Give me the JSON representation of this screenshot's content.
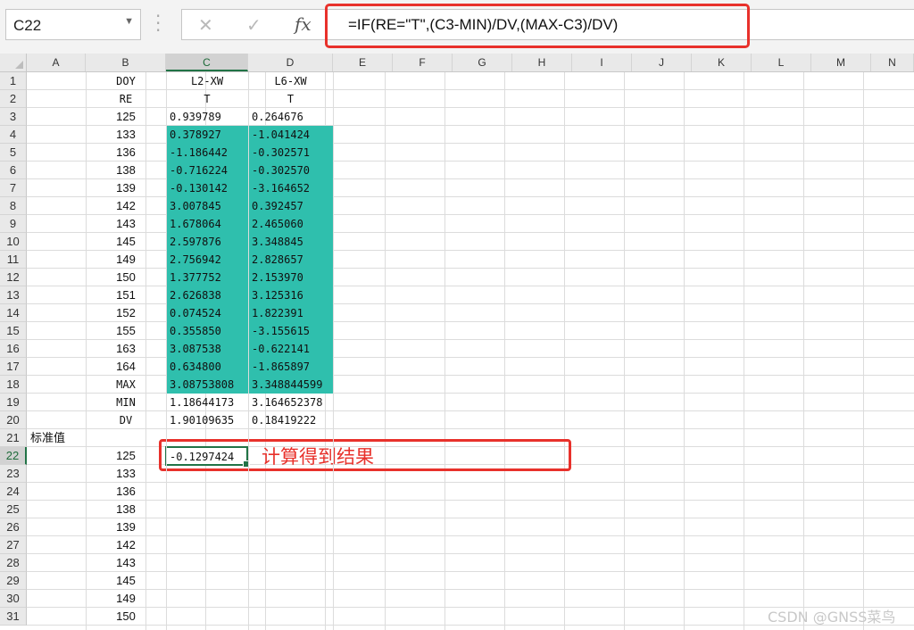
{
  "name_box": {
    "value": "C22"
  },
  "formula_bar": {
    "formula": "=IF(RE=\"T\",(C3-MIN)/DV,(MAX-C3)/DV)"
  },
  "columns": [
    "A",
    "B",
    "C",
    "D",
    "E",
    "F",
    "G",
    "H",
    "I",
    "J",
    "K",
    "L",
    "M",
    "N"
  ],
  "rows": [
    "1",
    "2",
    "3",
    "4",
    "5",
    "6",
    "7",
    "8",
    "9",
    "10",
    "11",
    "12",
    "13",
    "14",
    "15",
    "16",
    "17",
    "18",
    "19",
    "20",
    "21",
    "22",
    "23",
    "24",
    "25",
    "26",
    "27",
    "28",
    "29",
    "30",
    "31"
  ],
  "active_cell": "C22",
  "table": {
    "header_row1": {
      "b": "DOY",
      "c": "L2-XW",
      "d": "L6-XW"
    },
    "header_row2": {
      "b": "RE",
      "c": "T",
      "d": "T"
    },
    "data": [
      {
        "b": "125",
        "c": "0.939789",
        "d": "0.264676"
      },
      {
        "b": "133",
        "c": "0.378927",
        "d": "-1.041424"
      },
      {
        "b": "136",
        "c": "-1.186442",
        "d": "-0.302571"
      },
      {
        "b": "138",
        "c": "-0.716224",
        "d": "-0.302570"
      },
      {
        "b": "139",
        "c": "-0.130142",
        "d": "-3.164652"
      },
      {
        "b": "142",
        "c": "3.007845",
        "d": "0.392457"
      },
      {
        "b": "143",
        "c": "1.678064",
        "d": "2.465060"
      },
      {
        "b": "145",
        "c": "2.597876",
        "d": "3.348845"
      },
      {
        "b": "149",
        "c": "2.756942",
        "d": "2.828657"
      },
      {
        "b": "150",
        "c": "1.377752",
        "d": "2.153970"
      },
      {
        "b": "151",
        "c": "2.626838",
        "d": "3.125316"
      },
      {
        "b": "152",
        "c": "0.074524",
        "d": "1.822391"
      },
      {
        "b": "155",
        "c": "0.355850",
        "d": "-3.155615"
      },
      {
        "b": "163",
        "c": "3.087538",
        "d": "-0.622141"
      },
      {
        "b": "164",
        "c": "0.634800",
        "d": "-1.865897"
      }
    ],
    "stats": [
      {
        "b": "MAX",
        "c": "3.08753808",
        "d": "3.348844599"
      },
      {
        "b": "MIN",
        "c": "1.18644173",
        "d": "3.164652378"
      },
      {
        "b": "DV",
        "c": "1.90109635",
        "d": "0.18419222"
      }
    ]
  },
  "section_label": "标准值",
  "result_cell": "-0.1297424",
  "lower_doy": [
    "125",
    "133",
    "136",
    "138",
    "139",
    "142",
    "143",
    "145",
    "149",
    "150"
  ],
  "annotation": "计算得到结果",
  "watermark": "CSDN @GNSS菜鸟",
  "colors": {
    "teal": "#2fbfad",
    "red": "#e8312b",
    "excel_green": "#217346"
  }
}
